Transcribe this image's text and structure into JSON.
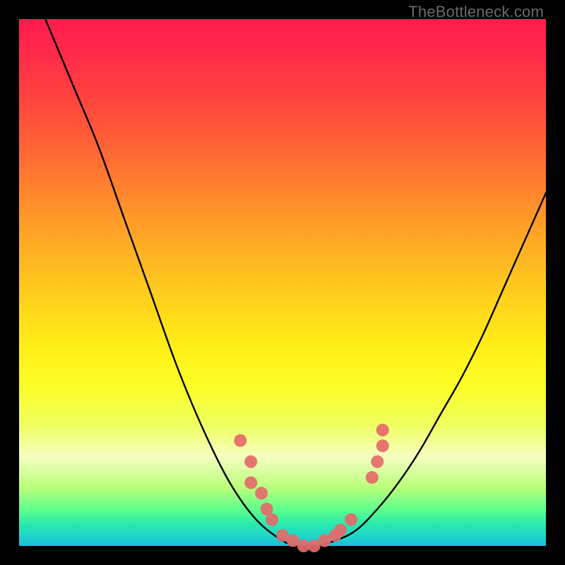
{
  "watermark": "TheBottleneck.com",
  "chart_data": {
    "type": "line",
    "title": "",
    "xlabel": "",
    "ylabel": "",
    "xlim": [
      0,
      100
    ],
    "ylim": [
      0,
      100
    ],
    "series": [
      {
        "name": "bottleneck-curve",
        "x": [
          5,
          10,
          15,
          20,
          25,
          30,
          35,
          40,
          45,
          50,
          53,
          56,
          60,
          64,
          68,
          72,
          76,
          80,
          84,
          88,
          92,
          96,
          100
        ],
        "values": [
          100,
          88,
          76,
          62,
          48,
          34,
          22,
          12,
          5,
          1,
          0,
          0,
          1,
          3,
          7,
          12,
          18,
          25,
          32,
          40,
          49,
          58,
          67
        ]
      }
    ],
    "markers": [
      {
        "x": 42,
        "y": 20
      },
      {
        "x": 44,
        "y": 16
      },
      {
        "x": 44,
        "y": 12
      },
      {
        "x": 46,
        "y": 10
      },
      {
        "x": 47,
        "y": 7
      },
      {
        "x": 48,
        "y": 5
      },
      {
        "x": 50,
        "y": 2
      },
      {
        "x": 52,
        "y": 1
      },
      {
        "x": 54,
        "y": 0
      },
      {
        "x": 56,
        "y": 0
      },
      {
        "x": 58,
        "y": 1
      },
      {
        "x": 60,
        "y": 2
      },
      {
        "x": 61,
        "y": 3
      },
      {
        "x": 63,
        "y": 5
      },
      {
        "x": 67,
        "y": 13
      },
      {
        "x": 68,
        "y": 16
      },
      {
        "x": 69,
        "y": 19
      },
      {
        "x": 69,
        "y": 22
      }
    ],
    "marker_color": "#e46a6a",
    "gradient_stops": [
      {
        "pos": 0,
        "color": "#ff1a4d"
      },
      {
        "pos": 24,
        "color": "#ff6335"
      },
      {
        "pos": 54,
        "color": "#ffd41c"
      },
      {
        "pos": 83,
        "color": "#f6ffc0"
      },
      {
        "pos": 93,
        "color": "#5fff8c"
      },
      {
        "pos": 100,
        "color": "#1abfd9"
      }
    ]
  }
}
